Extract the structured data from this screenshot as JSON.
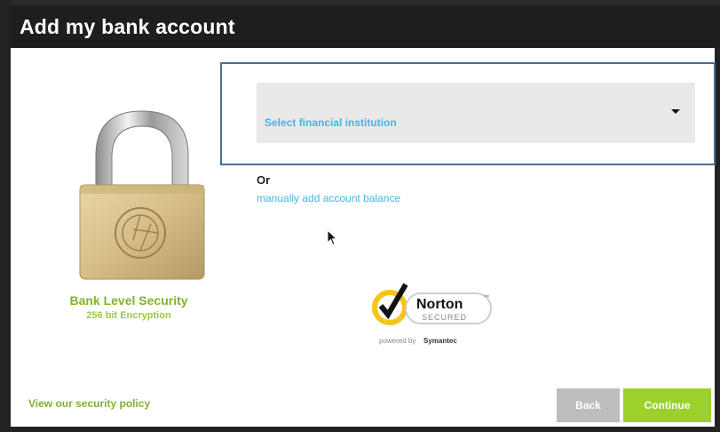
{
  "dialog": {
    "title": "Add my bank account"
  },
  "security": {
    "title": "Bank Level Security",
    "subtitle": "256 bit Encryption",
    "policy_link": "View our security policy"
  },
  "institution_select": {
    "selected_label": "Select financial institution"
  },
  "alternative": {
    "or_text": "Or",
    "manual_link": "manually add account balance"
  },
  "norton_badge": {
    "brand": "Norton",
    "secured": "SECURED",
    "tm": "™",
    "powered_prefix": "powered by",
    "powered_brand": "Symantec"
  },
  "footer": {
    "back_label": "Back",
    "continue_label": "Continue"
  },
  "colors": {
    "titlebar": "#1e1e1e",
    "link_blue": "#45b5e3",
    "green": "#84b12d",
    "continue_green": "#9bd12a",
    "back_gray": "#bdbdbd",
    "frame_blue": "#4c6e92"
  },
  "icons": [
    "padlock-icon",
    "norton-check-icon",
    "dropdown-caret-icon",
    "mouse-cursor-icon"
  ]
}
